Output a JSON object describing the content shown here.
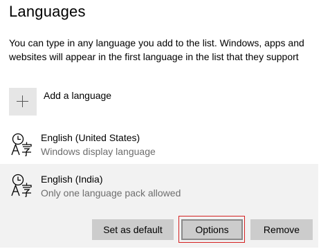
{
  "page": {
    "title": "Languages",
    "description": "You can type in any language you add to the list. Windows, apps and websites will appear in the first language in the list that they support"
  },
  "add_language": {
    "label": "Add a language",
    "icon": "plus-icon"
  },
  "languages": [
    {
      "name": "English (United States)",
      "subtitle": "Windows display language",
      "icon": "language-icon"
    },
    {
      "name": "English (India)",
      "subtitle": "Only one language pack allowed",
      "icon": "language-icon",
      "selected": true
    }
  ],
  "actions": {
    "set_default_label": "Set as default",
    "options_label": "Options",
    "remove_label": "Remove"
  },
  "colors": {
    "selected_row_bg": "#f2f2f2",
    "button_bg": "#cccccc",
    "highlight_border": "#d42020",
    "secondary_text": "#6d6d6d"
  }
}
